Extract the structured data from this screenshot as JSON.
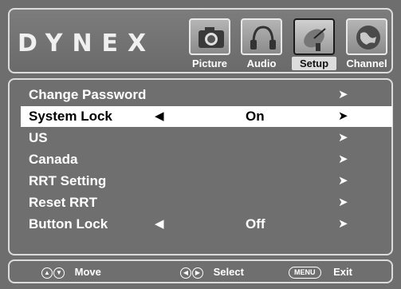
{
  "brand": "DYNEX",
  "tabs": [
    {
      "label": "Picture",
      "icon": "camera-icon",
      "active": false
    },
    {
      "label": "Audio",
      "icon": "headphones-icon",
      "active": false
    },
    {
      "label": "Setup",
      "icon": "satellite-dish-icon",
      "active": true
    },
    {
      "label": "Channel",
      "icon": "globe-icon",
      "active": false
    }
  ],
  "menu": {
    "items": [
      {
        "label": "Change Password",
        "value": "",
        "left_arrow": "",
        "right_arrow": "➤"
      },
      {
        "label": "System Lock",
        "value": "On",
        "left_arrow": "◀",
        "right_arrow": "➤",
        "selected": true
      },
      {
        "label": "US",
        "value": "",
        "left_arrow": "",
        "right_arrow": "➤"
      },
      {
        "label": "Canada",
        "value": "",
        "left_arrow": "",
        "right_arrow": "➤"
      },
      {
        "label": "RRT Setting",
        "value": "",
        "left_arrow": "",
        "right_arrow": "➤"
      },
      {
        "label": "Reset RRT",
        "value": "",
        "left_arrow": "",
        "right_arrow": "➤"
      },
      {
        "label": "Button Lock",
        "value": "Off",
        "left_arrow": "◀",
        "right_arrow": "➤"
      }
    ]
  },
  "footer": {
    "move_label": "Move",
    "select_label": "Select",
    "menu_button": "MENU",
    "exit_label": "Exit",
    "up_glyph": "▲",
    "down_glyph": "▼",
    "left_glyph": "◀",
    "right_glyph": "▶"
  },
  "colors": {
    "background": "#6e6e6e",
    "border": "#dcdcdc",
    "highlight": "#ffffff",
    "text": "#ffffff"
  }
}
